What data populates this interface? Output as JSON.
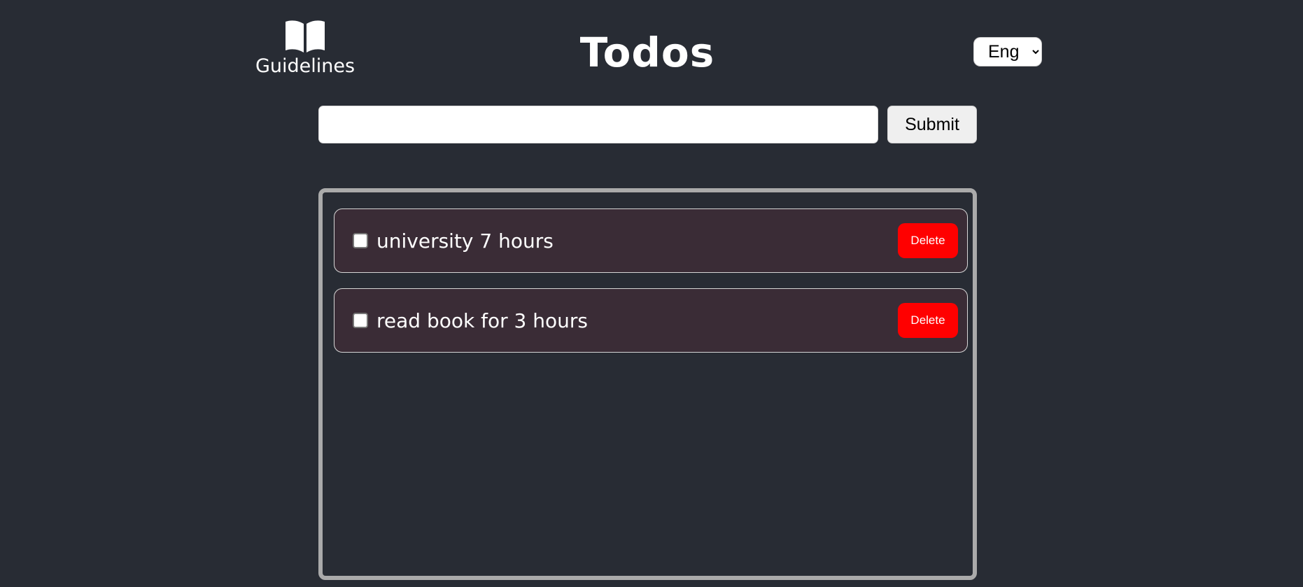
{
  "header": {
    "guidelines_label": "Guidelines",
    "guidelines_icon": "book-open-icon",
    "title": "Todos",
    "language": {
      "selected": "Eng"
    }
  },
  "form": {
    "input_value": "",
    "submit_label": "Submit"
  },
  "todos": [
    {
      "text": "university 7 hours",
      "checked": false,
      "delete_label": "Delete"
    },
    {
      "text": "read book for 3 hours",
      "checked": false,
      "delete_label": "Delete"
    }
  ],
  "colors": {
    "background": "#282c34",
    "item_background": "#3a2c36",
    "delete_button": "#ff0000",
    "list_border": "#aaaaaa"
  }
}
